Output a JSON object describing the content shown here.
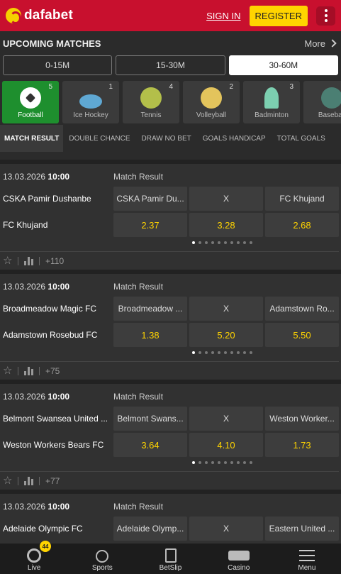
{
  "header": {
    "logo_text": "dafabet",
    "sign_in": "SIGN IN",
    "register": "REGISTER"
  },
  "upcoming": {
    "title": "UPCOMING MATCHES",
    "more": "More",
    "time_tabs": [
      {
        "label": "0-15M",
        "active": false
      },
      {
        "label": "15-30M",
        "active": false
      },
      {
        "label": "30-60M",
        "active": true
      }
    ]
  },
  "sports": [
    {
      "label": "Football",
      "count": "5",
      "icon": "football-icon",
      "active": true
    },
    {
      "label": "Ice Hockey",
      "count": "1",
      "icon": "ice-hockey-icon",
      "active": false
    },
    {
      "label": "Tennis",
      "count": "4",
      "icon": "tennis-icon",
      "active": false
    },
    {
      "label": "Volleyball",
      "count": "2",
      "icon": "volleyball-icon",
      "active": false
    },
    {
      "label": "Badminton",
      "count": "3",
      "icon": "badminton-icon",
      "active": false
    },
    {
      "label": "Baseball",
      "count": "",
      "icon": "baseball-icon",
      "active": false
    }
  ],
  "market_tabs": [
    "MATCH RESULT",
    "DOUBLE CHANCE",
    "DRAW NO BET",
    "GOALS HANDICAP",
    "TOTAL GOALS"
  ],
  "matches": [
    {
      "date": "13.03.2026",
      "time": "10:00",
      "market": "Match Result",
      "team1": "CSKA Pamir Dushanbe",
      "team2": "FC Khujand",
      "outcomes": [
        "CSKA Pamir Du...",
        "X",
        "FC Khujand"
      ],
      "odds": [
        "2.37",
        "3.28",
        "2.68"
      ],
      "more": "+110"
    },
    {
      "date": "13.03.2026",
      "time": "10:00",
      "market": "Match Result",
      "team1": "Broadmeadow Magic FC",
      "team2": "Adamstown Rosebud FC",
      "outcomes": [
        "Broadmeadow ...",
        "X",
        "Adamstown Ro..."
      ],
      "odds": [
        "1.38",
        "5.20",
        "5.50"
      ],
      "more": "+75"
    },
    {
      "date": "13.03.2026",
      "time": "10:00",
      "market": "Match Result",
      "team1": "Belmont Swansea United ...",
      "team2": "Weston Workers Bears FC",
      "outcomes": [
        "Belmont Swans...",
        "X",
        "Weston Worker..."
      ],
      "odds": [
        "3.64",
        "4.10",
        "1.73"
      ],
      "more": "+77"
    },
    {
      "date": "13.03.2026",
      "time": "10:00",
      "market": "Match Result",
      "team1": "Adelaide Olympic FC",
      "team2": "",
      "outcomes": [
        "Adelaide Olymp...",
        "X",
        "Eastern United ..."
      ],
      "odds": [
        "",
        "",
        ""
      ],
      "more": ""
    }
  ],
  "bottom_nav": [
    {
      "label": "Live",
      "icon": "live-icon",
      "badge": "44"
    },
    {
      "label": "Sports",
      "icon": "stopwatch-icon"
    },
    {
      "label": "BetSlip",
      "icon": "betslip-icon"
    },
    {
      "label": "Casino",
      "icon": "slot-machine-icon"
    },
    {
      "label": "Menu",
      "icon": "hamburger-icon"
    }
  ],
  "colors": {
    "brand_red": "#c8102e",
    "accent_yellow": "#ffd400",
    "active_green": "#1e8f2e"
  }
}
